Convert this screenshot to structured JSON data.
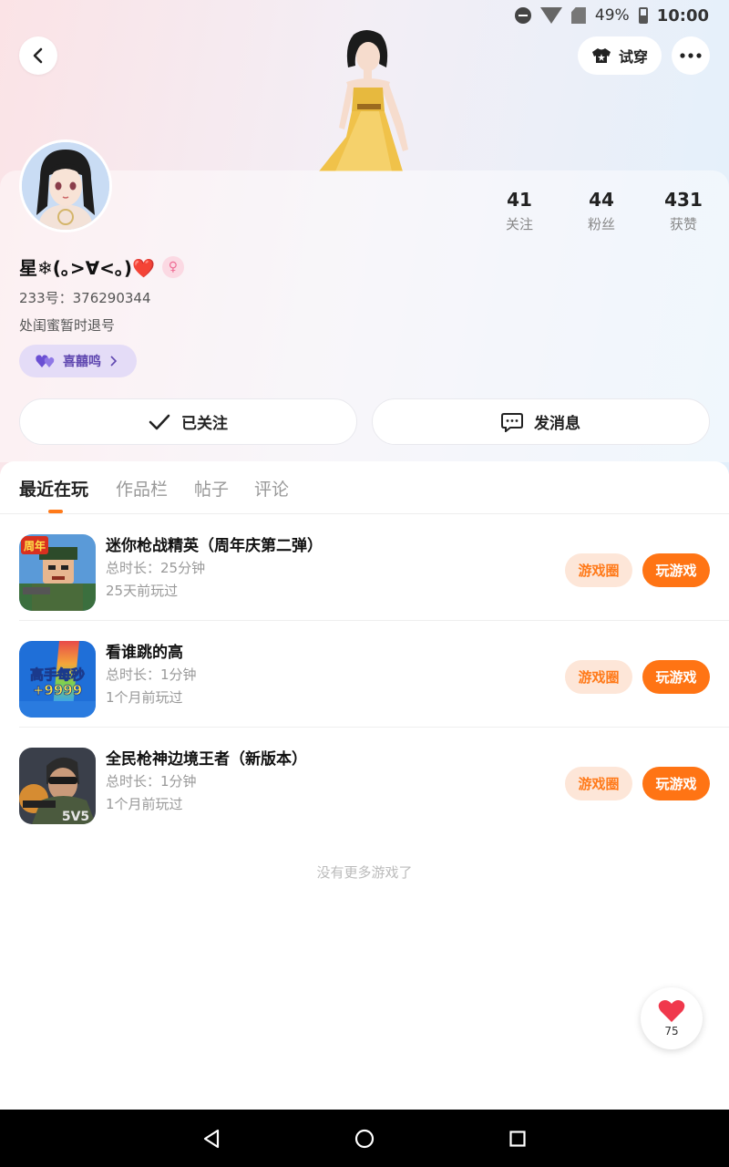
{
  "status_bar": {
    "battery": "49%",
    "time": "10:00"
  },
  "header": {
    "try_on_label": "试穿"
  },
  "profile": {
    "stats": [
      {
        "num": "41",
        "label": "关注"
      },
      {
        "num": "44",
        "label": "粉丝"
      },
      {
        "num": "431",
        "label": "获赞"
      }
    ],
    "nickname": "星❄(｡>∀<｡)❤️",
    "gender_symbol": "♀",
    "uid": "233号：376290344",
    "bio": "处闺蜜暂时退号",
    "tag_label": "喜囍鸣",
    "follow_label": "已关注",
    "message_label": "发消息"
  },
  "tabs": [
    "最近在玩",
    "作品栏",
    "帖子",
    "评论"
  ],
  "games": [
    {
      "title": "迷你枪战精英（周年庆第二弹）",
      "duration": "总时长：25分钟",
      "last_played": "25天前玩过",
      "circle_label": "游戏圈",
      "play_label": "玩游戏",
      "icon_text": "周年"
    },
    {
      "title": "看谁跳的高",
      "duration": "总时长：1分钟",
      "last_played": "1个月前玩过",
      "circle_label": "游戏圈",
      "play_label": "玩游戏",
      "icon_text": "高手每秒\n+9999"
    },
    {
      "title": "全民枪神边境王者（新版本）",
      "duration": "总时长：1分钟",
      "last_played": "1个月前玩过",
      "circle_label": "游戏圈",
      "play_label": "玩游戏",
      "icon_text": "5V5"
    }
  ],
  "no_more_text": "没有更多游戏了",
  "like_count": "75",
  "colors": {
    "accent": "#ff7414",
    "accent_light": "#fde6d8",
    "tag_purple": "#5f47b0"
  }
}
